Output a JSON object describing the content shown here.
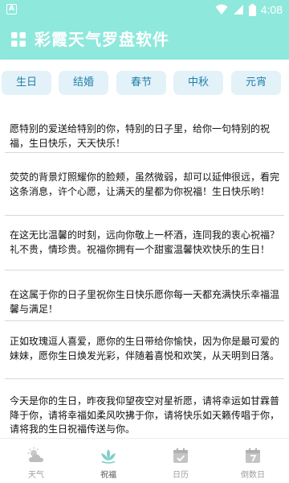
{
  "status_bar": {
    "time": "4:08",
    "left_icon_letter": "A"
  },
  "app_bar": {
    "title": "彩霞天气罗盘软件",
    "menu_icon": "grid-icon"
  },
  "tabs": [
    "生日",
    "结婚",
    "春节",
    "中秋",
    "元宵"
  ],
  "wishes": [
    "愿特别的爱送给特别的你，特别的日子里，给你一句特别的祝福，生日快乐，天天快乐！",
    "荧荧的背景灯照耀你的脸颊，虽然微弱，却可以延伸很远，看完这条消息，许个心愿，让满天的星都为你祝福！生日快乐哟！",
    "在这无比温馨的时刻，远向你敬上一杯酒，连同我的衷心祝福？礼不贵，情珍贵。祝福你拥有一个甜蜜温馨快欢快乐的生日！",
    "在这属于你的日子里祝你生日快乐愿你每一天都充满快乐幸福温馨与满足！",
    "正如玫瑰逗人喜爱，愿你的生日带给你愉快，因为你是最可爱的妹妹，愿你生日焕发光彩，伴随着喜悦和欢笑，从天明到日落。",
    "今天是你的生日，昨夜我仰望夜空对星祈愿，请将幸运如甘霖普降于你，请将幸福如柔风吹拂于你，请将快乐如天籁传唱于你，请将我的生日祝福传送与你。"
  ],
  "bottom_nav": [
    {
      "label": "天气",
      "icon": "weather-icon",
      "active": false
    },
    {
      "label": "祝福",
      "icon": "lotus-icon",
      "active": true
    },
    {
      "label": "日历",
      "icon": "calendar-icon",
      "active": false
    },
    {
      "label": "倒数日",
      "icon": "countdown-calendar-icon",
      "active": false
    }
  ],
  "colors": {
    "accent": "#8fe8dc",
    "tab_bg": "#e3f2f9",
    "tab_text": "#1f7faa",
    "nav_active": "#7ecfc6"
  }
}
